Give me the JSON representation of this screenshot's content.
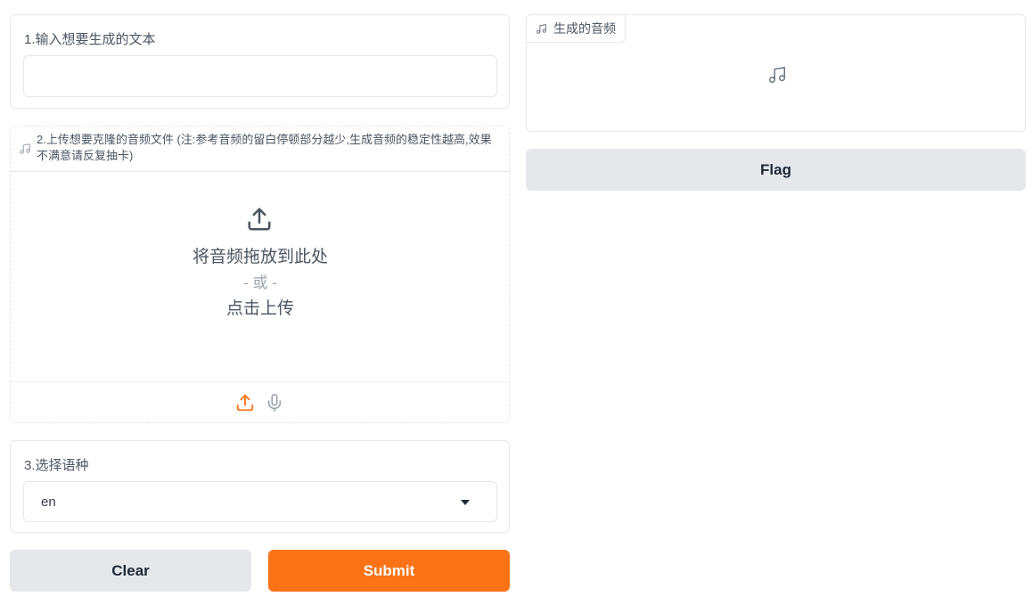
{
  "text_input": {
    "label": "1.输入想要生成的文本",
    "value": "",
    "placeholder": ""
  },
  "upload": {
    "label": "2.上传想要克隆的音频文件 (注:参考音频的留白停顿部分越少,生成音频的稳定性越高,效果不满意请反复抽卡)",
    "drop_text": "将音频拖放到此处",
    "or_text": "- 或 -",
    "click_text": "点击上传",
    "header_icon": "music-note-icon",
    "upload_icon": "upload-icon",
    "mic_icon": "microphone-icon"
  },
  "language": {
    "label": "3.选择语种",
    "selected": "en"
  },
  "buttons": {
    "clear": "Clear",
    "submit": "Submit",
    "flag": "Flag"
  },
  "output": {
    "label": "生成的音频",
    "icon": "music-note-icon"
  },
  "colors": {
    "accent": "#f97316",
    "secondary_button": "#e5e7eb",
    "border": "#e5e7eb"
  }
}
